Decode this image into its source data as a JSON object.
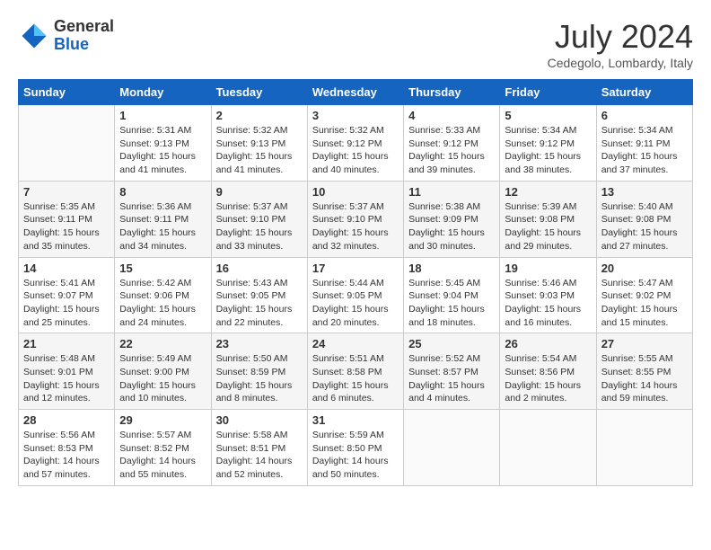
{
  "header": {
    "logo_general": "General",
    "logo_blue": "Blue",
    "title": "July 2024",
    "location": "Cedegolo, Lombardy, Italy"
  },
  "days_of_week": [
    "Sunday",
    "Monday",
    "Tuesday",
    "Wednesday",
    "Thursday",
    "Friday",
    "Saturday"
  ],
  "weeks": [
    [
      {
        "day": "",
        "content": ""
      },
      {
        "day": "1",
        "content": "Sunrise: 5:31 AM\nSunset: 9:13 PM\nDaylight: 15 hours\nand 41 minutes."
      },
      {
        "day": "2",
        "content": "Sunrise: 5:32 AM\nSunset: 9:13 PM\nDaylight: 15 hours\nand 41 minutes."
      },
      {
        "day": "3",
        "content": "Sunrise: 5:32 AM\nSunset: 9:12 PM\nDaylight: 15 hours\nand 40 minutes."
      },
      {
        "day": "4",
        "content": "Sunrise: 5:33 AM\nSunset: 9:12 PM\nDaylight: 15 hours\nand 39 minutes."
      },
      {
        "day": "5",
        "content": "Sunrise: 5:34 AM\nSunset: 9:12 PM\nDaylight: 15 hours\nand 38 minutes."
      },
      {
        "day": "6",
        "content": "Sunrise: 5:34 AM\nSunset: 9:11 PM\nDaylight: 15 hours\nand 37 minutes."
      }
    ],
    [
      {
        "day": "7",
        "content": "Sunrise: 5:35 AM\nSunset: 9:11 PM\nDaylight: 15 hours\nand 35 minutes."
      },
      {
        "day": "8",
        "content": "Sunrise: 5:36 AM\nSunset: 9:11 PM\nDaylight: 15 hours\nand 34 minutes."
      },
      {
        "day": "9",
        "content": "Sunrise: 5:37 AM\nSunset: 9:10 PM\nDaylight: 15 hours\nand 33 minutes."
      },
      {
        "day": "10",
        "content": "Sunrise: 5:37 AM\nSunset: 9:10 PM\nDaylight: 15 hours\nand 32 minutes."
      },
      {
        "day": "11",
        "content": "Sunrise: 5:38 AM\nSunset: 9:09 PM\nDaylight: 15 hours\nand 30 minutes."
      },
      {
        "day": "12",
        "content": "Sunrise: 5:39 AM\nSunset: 9:08 PM\nDaylight: 15 hours\nand 29 minutes."
      },
      {
        "day": "13",
        "content": "Sunrise: 5:40 AM\nSunset: 9:08 PM\nDaylight: 15 hours\nand 27 minutes."
      }
    ],
    [
      {
        "day": "14",
        "content": "Sunrise: 5:41 AM\nSunset: 9:07 PM\nDaylight: 15 hours\nand 25 minutes."
      },
      {
        "day": "15",
        "content": "Sunrise: 5:42 AM\nSunset: 9:06 PM\nDaylight: 15 hours\nand 24 minutes."
      },
      {
        "day": "16",
        "content": "Sunrise: 5:43 AM\nSunset: 9:05 PM\nDaylight: 15 hours\nand 22 minutes."
      },
      {
        "day": "17",
        "content": "Sunrise: 5:44 AM\nSunset: 9:05 PM\nDaylight: 15 hours\nand 20 minutes."
      },
      {
        "day": "18",
        "content": "Sunrise: 5:45 AM\nSunset: 9:04 PM\nDaylight: 15 hours\nand 18 minutes."
      },
      {
        "day": "19",
        "content": "Sunrise: 5:46 AM\nSunset: 9:03 PM\nDaylight: 15 hours\nand 16 minutes."
      },
      {
        "day": "20",
        "content": "Sunrise: 5:47 AM\nSunset: 9:02 PM\nDaylight: 15 hours\nand 15 minutes."
      }
    ],
    [
      {
        "day": "21",
        "content": "Sunrise: 5:48 AM\nSunset: 9:01 PM\nDaylight: 15 hours\nand 12 minutes."
      },
      {
        "day": "22",
        "content": "Sunrise: 5:49 AM\nSunset: 9:00 PM\nDaylight: 15 hours\nand 10 minutes."
      },
      {
        "day": "23",
        "content": "Sunrise: 5:50 AM\nSunset: 8:59 PM\nDaylight: 15 hours\nand 8 minutes."
      },
      {
        "day": "24",
        "content": "Sunrise: 5:51 AM\nSunset: 8:58 PM\nDaylight: 15 hours\nand 6 minutes."
      },
      {
        "day": "25",
        "content": "Sunrise: 5:52 AM\nSunset: 8:57 PM\nDaylight: 15 hours\nand 4 minutes."
      },
      {
        "day": "26",
        "content": "Sunrise: 5:54 AM\nSunset: 8:56 PM\nDaylight: 15 hours\nand 2 minutes."
      },
      {
        "day": "27",
        "content": "Sunrise: 5:55 AM\nSunset: 8:55 PM\nDaylight: 14 hours\nand 59 minutes."
      }
    ],
    [
      {
        "day": "28",
        "content": "Sunrise: 5:56 AM\nSunset: 8:53 PM\nDaylight: 14 hours\nand 57 minutes."
      },
      {
        "day": "29",
        "content": "Sunrise: 5:57 AM\nSunset: 8:52 PM\nDaylight: 14 hours\nand 55 minutes."
      },
      {
        "day": "30",
        "content": "Sunrise: 5:58 AM\nSunset: 8:51 PM\nDaylight: 14 hours\nand 52 minutes."
      },
      {
        "day": "31",
        "content": "Sunrise: 5:59 AM\nSunset: 8:50 PM\nDaylight: 14 hours\nand 50 minutes."
      },
      {
        "day": "",
        "content": ""
      },
      {
        "day": "",
        "content": ""
      },
      {
        "day": "",
        "content": ""
      }
    ]
  ]
}
